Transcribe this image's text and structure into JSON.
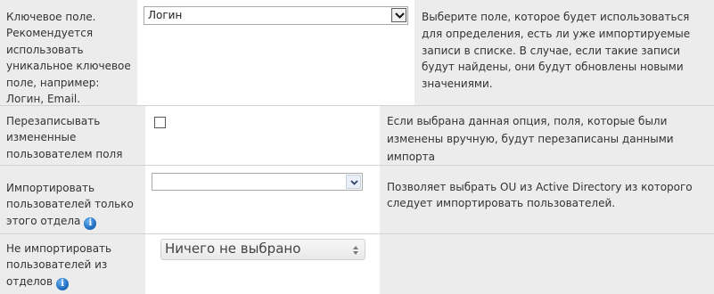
{
  "rows": [
    {
      "label": "Ключевое поле. Рекомендуется использовать уникальное ключевое поле, например: Логин, Email.",
      "control": {
        "type": "select",
        "value": "Логин"
      },
      "description": "Выберите поле, которое будет использоваться для определения, есть ли уже импортируемые записи в списке. В случае, если такие записи будут найдены, они будут обновлены новыми значениями."
    },
    {
      "label": "Перезаписывать измененные пользователем поля",
      "control": {
        "type": "checkbox",
        "checked": false
      },
      "description": "Если выбрана данная опция, поля, которые были изменены вручную, будут перезаписаны данными импорта"
    },
    {
      "label": "Импортировать пользователей только этого отдела",
      "control": {
        "type": "select",
        "value": ""
      },
      "description": "Позволяет выбрать OU из Active Directory из которого следует импортировать пользователей.",
      "icon": "info-icon"
    },
    {
      "label": "Не импортировать пользователей из отделов",
      "control": {
        "type": "multiselect",
        "value": "Ничего не выбрано"
      },
      "description": "",
      "icon": "info-icon"
    }
  ],
  "colors": {
    "row_background": "#ececec",
    "border": "#d4d4d4",
    "info_icon": "#1f6fc4"
  }
}
